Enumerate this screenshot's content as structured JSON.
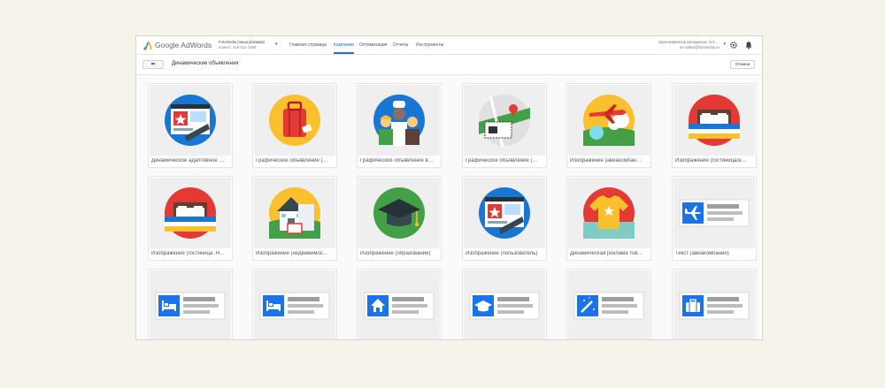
{
  "header": {
    "logo_text": "Google AdWords",
    "account_name": "Forumedia (наша реклама)",
    "account_sub": "Клиент: 618-312-2889",
    "nav": [
      "Главная страница",
      "Кампании",
      "Оптимизация",
      "Отчеты",
      "Инструменты"
    ],
    "active_nav_index": 1,
    "customer_line1": "Идентификатор менеджера: 414-…",
    "customer_line2": "om.editor@forumedia.ru",
    "icons": [
      "settings-gear-icon",
      "notification-bell-icon"
    ]
  },
  "toolbar": {
    "back_label": "⬅",
    "title": "Динамические объявления",
    "cancel_label": "Отмена"
  },
  "colors": {
    "accent": "#1a73e8",
    "thumb_bg": "#efefef",
    "page_bg": "#f5f3ea"
  },
  "templates": [
    {
      "label": "Динамическое адаптивное …",
      "icon": "adaptive-window-icon"
    },
    {
      "label": "Графическое объявление (…",
      "icon": "luggage-icon"
    },
    {
      "label": "Графическое объявление в…",
      "icon": "people-workers-icon"
    },
    {
      "label": "Графическое объявление (…",
      "icon": "map-ticket-icon"
    },
    {
      "label": "Изображение (авиакомпан…",
      "icon": "airplane-icon"
    },
    {
      "label": "Изображение (гостиница/а…",
      "icon": "hotel-bed-icon"
    },
    {
      "label": "Изображение (гостиница, Н…",
      "icon": "hotel-bed-icon"
    },
    {
      "label": "Изображение (недвижимос…",
      "icon": "real-estate-house-icon"
    },
    {
      "label": "Изображение (образование)",
      "icon": "graduation-cap-icon"
    },
    {
      "label": "Изображение (пользователь)",
      "icon": "adaptive-window-icon"
    },
    {
      "label": "Динамическая реклама тов…",
      "icon": "tshirt-icon"
    },
    {
      "label": "Текст (авиакомпании)",
      "icon": "text-airplane-icon"
    },
    {
      "label": "",
      "icon": "text-bed-icon"
    },
    {
      "label": "",
      "icon": "text-bed-icon"
    },
    {
      "label": "",
      "icon": "text-house-icon"
    },
    {
      "label": "",
      "icon": "text-graduation-cap-icon"
    },
    {
      "label": "",
      "icon": "text-magic-wand-icon"
    },
    {
      "label": "",
      "icon": "text-briefcase-icon"
    }
  ]
}
